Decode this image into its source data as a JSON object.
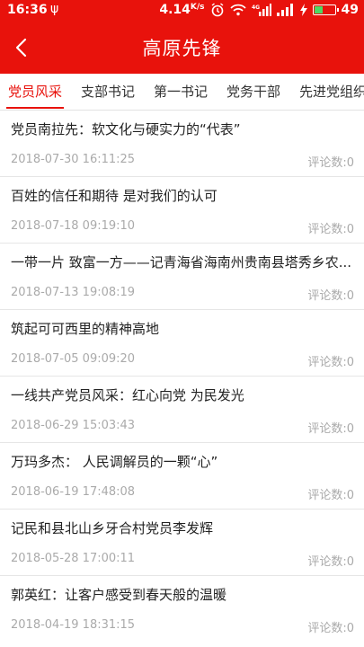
{
  "status": {
    "time": "16:36",
    "speed_value": "4.14",
    "speed_unit": "K/s",
    "network": "4G",
    "battery": "49",
    "battery_level_percent": 49
  },
  "header": {
    "title": "高原先锋"
  },
  "tabs": [
    {
      "label": "党员风采",
      "active": true
    },
    {
      "label": "支部书记",
      "active": false
    },
    {
      "label": "第一书记",
      "active": false
    },
    {
      "label": "党务干部",
      "active": false
    },
    {
      "label": "先进党组织",
      "active": false
    }
  ],
  "articles": [
    {
      "title": "党员南拉先：软文化与硬实力的“代表”",
      "date": "2018-07-30 16:11:25",
      "comments": "评论数:0"
    },
    {
      "title": "百姓的信任和期待 是对我们的认可",
      "date": "2018-07-18 09:19:10",
      "comments": "评论数:0"
    },
    {
      "title": "一带一片 致富一方——记青海省海南州贵南县塔秀乡农...",
      "date": "2018-07-13 19:08:19",
      "comments": "评论数:0"
    },
    {
      "title": "筑起可可西里的精神高地",
      "date": "2018-07-05 09:09:20",
      "comments": "评论数:0"
    },
    {
      "title": "一线共产党员风采：红心向党 为民发光",
      "date": "2018-06-29 15:03:43",
      "comments": "评论数:0"
    },
    {
      "title": "万玛多杰： 人民调解员的一颗“心”",
      "date": "2018-06-19 17:48:08",
      "comments": "评论数:0"
    },
    {
      "title": "记民和县北山乡牙合村党员李发辉",
      "date": "2018-05-28 17:00:11",
      "comments": "评论数:0"
    },
    {
      "title": "郭英红：让客户感受到春天般的温暖",
      "date": "2018-04-19 18:31:15",
      "comments": "评论数:0"
    }
  ],
  "colors": {
    "brand": "#e8120c",
    "meta_text": "#aaaaaa"
  }
}
